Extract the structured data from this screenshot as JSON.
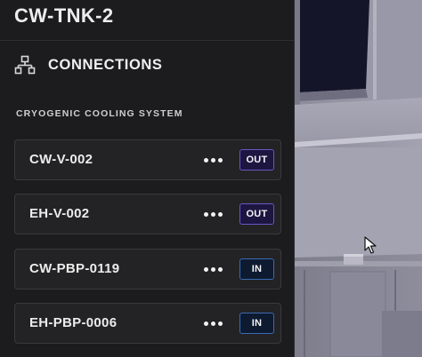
{
  "header": {
    "title": "CW-TNK-2"
  },
  "section": {
    "icon": "network-icon",
    "label": "CONNECTIONS"
  },
  "group": {
    "label": "CRYOGENIC COOLING SYSTEM"
  },
  "connections": [
    {
      "name": "CW-V-002",
      "direction": "OUT",
      "more_icon": "more-horizontal-icon"
    },
    {
      "name": "EH-V-002",
      "direction": "OUT",
      "more_icon": "more-horizontal-icon"
    },
    {
      "name": "CW-PBP-0119",
      "direction": "IN",
      "more_icon": "more-horizontal-icon"
    },
    {
      "name": "EH-PBP-0006",
      "direction": "IN",
      "more_icon": "more-horizontal-icon"
    }
  ],
  "colors": {
    "panel_bg": "#1c1c1e",
    "item_bg": "#232325",
    "out_badge_bg": "#1d1640",
    "out_badge_border": "#6b55c4",
    "in_badge_bg": "#0e1a2f",
    "in_badge_border": "#3a6ab4",
    "viewport_wall": "#9a99a8"
  },
  "viewport": {
    "cursor_icon": "mouse-pointer-icon"
  }
}
